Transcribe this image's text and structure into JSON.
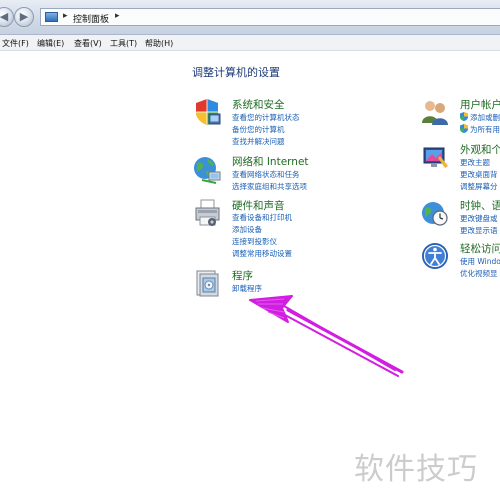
{
  "addressbar": {
    "crumb": "控制面板",
    "sep": "▸"
  },
  "menu": [
    "文件(F)",
    "编辑(E)",
    "查看(V)",
    "工具(T)",
    "帮助(H)"
  ],
  "page_title": "调整计算机的设置",
  "categories_left": [
    {
      "title": "系统和安全",
      "icon": "shield-icon",
      "links": [
        "查看您的计算机状态",
        "备份您的计算机",
        "查找并解决问题"
      ]
    },
    {
      "title": "网络和 Internet",
      "icon": "globe-network-icon",
      "links": [
        "查看网络状态和任务",
        "选择家庭组和共享选项"
      ]
    },
    {
      "title": "硬件和声音",
      "icon": "printer-icon",
      "links": [
        "查看设备和打印机",
        "添加设备",
        "连接到投影仪",
        "调整常用移动设置"
      ]
    },
    {
      "title": "程序",
      "icon": "programs-icon",
      "links": [
        "卸载程序"
      ]
    }
  ],
  "categories_right": [
    {
      "title": "用户帐户",
      "icon": "users-icon",
      "links": [
        "添加或删",
        "为所有用"
      ]
    },
    {
      "title": "外观和个",
      "icon": "appearance-icon",
      "links": [
        "更改主题",
        "更改桌面背",
        "调整屏幕分"
      ]
    },
    {
      "title": "时钟、语",
      "icon": "clock-icon",
      "links": [
        "更改键盘或",
        "更改显示语"
      ]
    },
    {
      "title": "轻松访问",
      "icon": "accessibility-icon",
      "links": [
        "使用 Windo",
        "优化视频显"
      ]
    }
  ],
  "watermark": "软件技巧",
  "colors": {
    "title_green": "#1f6b24",
    "link_blue": "#1a5fb4",
    "heading_blue": "#1c3a78",
    "annotation_magenta": "#d21ee0"
  }
}
